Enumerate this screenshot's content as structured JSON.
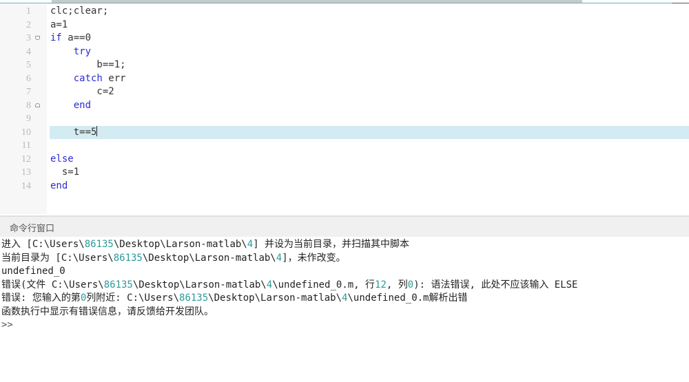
{
  "colors": {
    "keyword": "#2b2bd4",
    "number": "#2c9a9a",
    "current_line": "#d3ebf2"
  },
  "editor": {
    "current_line": 10,
    "lines": [
      {
        "n": "1",
        "tokens": [
          {
            "t": "clc;clear;"
          }
        ]
      },
      {
        "n": "2",
        "tokens": [
          {
            "t": "a=1"
          }
        ]
      },
      {
        "n": "3",
        "fold": "start",
        "tokens": [
          {
            "t": "if",
            "k": 1
          },
          {
            "t": " a==0"
          }
        ]
      },
      {
        "n": "4",
        "tokens": [
          {
            "t": "    "
          },
          {
            "t": "try",
            "k": 1
          }
        ]
      },
      {
        "n": "5",
        "tokens": [
          {
            "t": "        b==1;"
          }
        ]
      },
      {
        "n": "6",
        "tokens": [
          {
            "t": "    "
          },
          {
            "t": "catch",
            "k": 1
          },
          {
            "t": " err"
          }
        ]
      },
      {
        "n": "7",
        "tokens": [
          {
            "t": "        c=2"
          }
        ]
      },
      {
        "n": "8",
        "fold": "end",
        "tokens": [
          {
            "t": "    "
          },
          {
            "t": "end",
            "k": 1
          }
        ]
      },
      {
        "n": "9",
        "tokens": []
      },
      {
        "n": "10",
        "tokens": [
          {
            "t": "    t==5"
          }
        ]
      },
      {
        "n": "11",
        "tokens": []
      },
      {
        "n": "12",
        "tokens": [
          {
            "t": "else",
            "k": 1
          }
        ]
      },
      {
        "n": "13",
        "tokens": [
          {
            "t": "  s=1"
          }
        ]
      },
      {
        "n": "14",
        "tokens": [
          {
            "t": "end",
            "k": 1
          }
        ]
      }
    ]
  },
  "command_window": {
    "title": "命令行窗口",
    "prompt": ">>",
    "lines": [
      [
        {
          "t": "进入 [C:\\Users\\"
        },
        {
          "t": "86135",
          "n": 1
        },
        {
          "t": "\\Desktop\\Larson-matlab\\"
        },
        {
          "t": "4",
          "n": 1
        },
        {
          "t": "] 并设为当前目录，并扫描其中脚本"
        }
      ],
      [
        {
          "t": "当前目录为 [C:\\Users\\"
        },
        {
          "t": "86135",
          "n": 1
        },
        {
          "t": "\\Desktop\\Larson-matlab\\"
        },
        {
          "t": "4",
          "n": 1
        },
        {
          "t": "]，未作改变。"
        }
      ],
      [
        {
          "t": "undefined_0"
        }
      ],
      [
        {
          "t": "错误(文件 C:\\Users\\"
        },
        {
          "t": "86135",
          "n": 1
        },
        {
          "t": "\\Desktop\\Larson-matlab\\"
        },
        {
          "t": "4",
          "n": 1
        },
        {
          "t": "\\undefined_0.m, 行"
        },
        {
          "t": "12",
          "n": 1
        },
        {
          "t": ", 列"
        },
        {
          "t": "0",
          "n": 1
        },
        {
          "t": "): 语法错误, 此处不应该输入 ELSE"
        }
      ],
      [
        {
          "t": "错误: 您输入的第"
        },
        {
          "t": "0",
          "n": 1
        },
        {
          "t": "列附近: C:\\Users\\"
        },
        {
          "t": "86135",
          "n": 1
        },
        {
          "t": "\\Desktop\\Larson-matlab\\"
        },
        {
          "t": "4",
          "n": 1
        },
        {
          "t": "\\undefined_0.m解析出错"
        }
      ],
      [
        {
          "t": "函数执行中显示有错误信息，请反馈给开发团队。"
        }
      ]
    ]
  }
}
